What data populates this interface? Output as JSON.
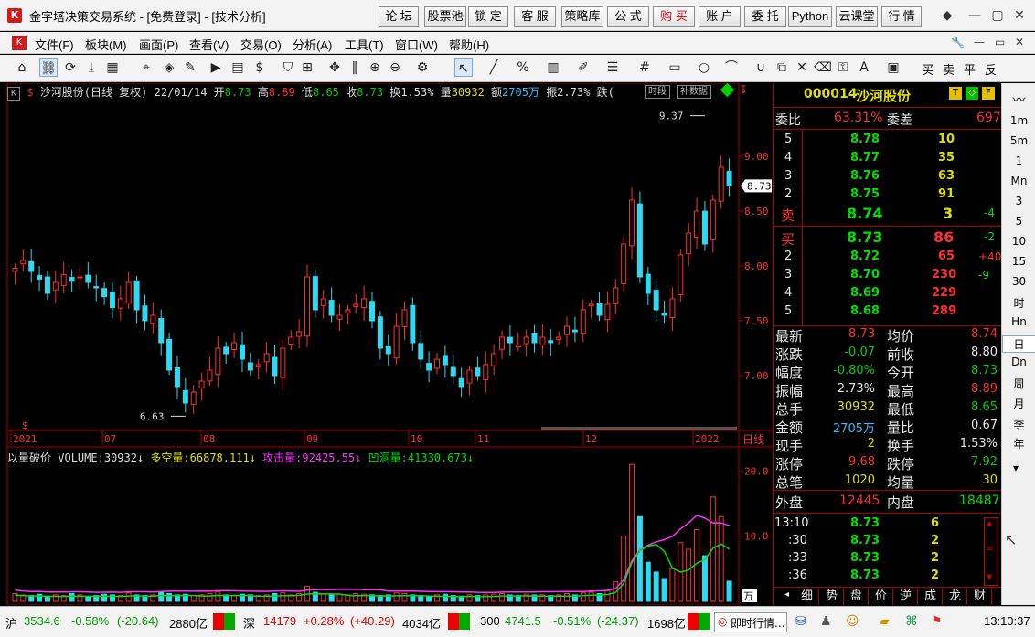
{
  "title_bar": {
    "icon": "K",
    "title": "金字塔决策交易系统 - [免费登录] - [技术分析]",
    "buttons": [
      "论 坛",
      "股票池",
      "锁 定",
      "客 服",
      "策略库",
      "公 式",
      "购 买",
      "账 户",
      "委 托",
      "Python",
      "云课堂",
      "行 情"
    ],
    "button_colors": [
      "#000000",
      "#000000",
      "#000000",
      "#000000",
      "#000000",
      "#000000",
      "#e00000",
      "#000000",
      "#000000",
      "#000000",
      "#000000",
      "#000000"
    ],
    "window_controls": [
      "◆",
      "—",
      "▢",
      "✕"
    ]
  },
  "menu": {
    "items": [
      "文件(F)",
      "板块(M)",
      "画面(P)",
      "查看(V)",
      "交易(O)",
      "分析(A)",
      "工具(T)",
      "窗口(W)",
      "帮助(H)"
    ],
    "mdi_controls": [
      "🔧",
      "—",
      "▭",
      "✕"
    ]
  },
  "toolbar": {
    "trade_buttons": [
      "买",
      "卖",
      "平",
      "反"
    ]
  },
  "kline_header": {
    "badge": "K",
    "name": "沙河股份(日线 复权) 22/01/14",
    "open_label": "开",
    "open": "8.73",
    "high_label": "高",
    "high": "8.89",
    "low_label": "低",
    "low": "8.65",
    "close_label": "收",
    "close": "8.73",
    "turnover_label": "换",
    "turnover": "1.53%",
    "volume_label": "量",
    "volume": "30932",
    "amount_label": "额",
    "amount": "2705万",
    "amplitude_label": "振",
    "amplitude": "2.73%",
    "change_label": "跌(",
    "tag_period": "时段",
    "tag_data": "补数据"
  },
  "volume_header": {
    "name": "以量破价",
    "volume_label": "VOLUME:",
    "volume": "30932",
    "duokong_label": "多空量:",
    "duokong": "66878.111",
    "gongji_label": "攻击量:",
    "gongji": "92425.55",
    "aodong_label": "凹洞量:",
    "aodong": "41330.673"
  },
  "chart_data": {
    "type": "candlestick",
    "title": "沙河股份(日线 复权)",
    "x_tick_labels": [
      "2021",
      "07",
      "08",
      "09",
      "10",
      "11",
      "12",
      "2022"
    ],
    "x_axis_unit": "日线",
    "price_axis": {
      "ticks": [
        7.0,
        7.5,
        8.0,
        8.5,
        9.0
      ],
      "range": [
        6.5,
        9.5
      ]
    },
    "volume_axis": {
      "ticks": [
        "20.0",
        "10.0"
      ],
      "unit": "万",
      "range": [
        0,
        22
      ]
    },
    "annotations": {
      "high": "9.37",
      "low": "6.63",
      "last": "8.73"
    },
    "close_series": [
      7.98,
      8.05,
      7.95,
      7.88,
      7.75,
      7.85,
      7.92,
      7.86,
      7.9,
      7.85,
      7.8,
      7.72,
      7.62,
      7.7,
      7.85,
      7.6,
      7.5,
      7.55,
      7.3,
      7.05,
      6.9,
      6.75,
      6.85,
      6.95,
      7.05,
      7.25,
      7.2,
      7.3,
      7.15,
      7.05,
      7.1,
      7.2,
      7.0,
      7.25,
      7.35,
      7.4,
      7.9,
      7.6,
      7.7,
      7.55,
      7.55,
      7.6,
      7.65,
      7.7,
      7.5,
      7.25,
      7.2,
      7.45,
      7.6,
      7.3,
      7.15,
      7.05,
      7.15,
      7.1,
      7.0,
      6.9,
      7.05,
      7.0,
      7.1,
      7.2,
      7.35,
      7.3,
      7.28,
      7.35,
      7.3,
      7.35,
      7.3,
      7.35,
      7.45,
      7.4,
      7.6,
      7.65,
      7.55,
      7.65,
      7.8,
      8.2,
      8.6,
      7.9,
      7.75,
      7.6,
      7.55,
      7.7,
      8.1,
      8.3,
      8.5,
      8.2,
      8.6,
      8.9,
      8.73
    ],
    "volume_series": [
      1.2,
      1.0,
      0.9,
      1.1,
      0.8,
      1.0,
      0.9,
      1.2,
      1.0,
      0.8,
      0.9,
      1.1,
      1.0,
      0.9,
      1.3,
      1.0,
      0.9,
      1.0,
      1.4,
      1.2,
      1.0,
      1.1,
      0.9,
      1.0,
      1.2,
      1.5,
      1.0,
      0.9,
      1.1,
      1.0,
      0.9,
      1.0,
      1.2,
      1.3,
      1.0,
      1.2,
      2.3,
      1.4,
      1.2,
      1.0,
      1.1,
      1.0,
      1.2,
      1.1,
      1.0,
      0.9,
      1.0,
      1.3,
      1.2,
      1.0,
      0.9,
      0.8,
      1.0,
      1.1,
      0.9,
      0.8,
      1.0,
      0.9,
      1.0,
      1.1,
      1.2,
      1.0,
      0.9,
      1.1,
      1.0,
      1.0,
      0.9,
      1.0,
      1.2,
      1.0,
      1.3,
      1.4,
      1.2,
      1.6,
      3.0,
      10.0,
      21.0,
      13.0,
      6.0,
      4.5,
      3.5,
      5.0,
      9.0,
      8.0,
      11.0,
      7.0,
      16.0,
      13.0,
      3.1
    ]
  },
  "quote": {
    "code": "000014",
    "name": "沙河股份",
    "weibi_label": "委比",
    "weibi": "63.31%",
    "weicha_label": "委差",
    "weicha": "697",
    "sells": [
      {
        "level": "5",
        "price": "8.78",
        "vol": "10",
        "chg": ""
      },
      {
        "level": "4",
        "price": "8.77",
        "vol": "35",
        "chg": ""
      },
      {
        "level": "3",
        "price": "8.76",
        "vol": "63",
        "chg": ""
      },
      {
        "level": "2",
        "price": "8.75",
        "vol": "91",
        "chg": ""
      }
    ],
    "sell1": {
      "label": "卖",
      "price": "8.74",
      "vol": "3",
      "chg": "-4"
    },
    "buy1": {
      "label": "买",
      "price": "8.73",
      "vol": "86",
      "chg": "-2"
    },
    "buys": [
      {
        "level": "2",
        "price": "8.72",
        "vol": "65",
        "chg": "+40"
      },
      {
        "level": "3",
        "price": "8.70",
        "vol": "230",
        "chg": "-9"
      },
      {
        "level": "4",
        "price": "8.69",
        "vol": "229",
        "chg": ""
      },
      {
        "level": "5",
        "price": "8.68",
        "vol": "289",
        "chg": ""
      }
    ],
    "stats": [
      {
        "l1": "最新",
        "v1": "8.73",
        "c1": "#ff3030",
        "l2": "均价",
        "v2": "8.74",
        "c2": "#ff3030"
      },
      {
        "l1": "涨跌",
        "v1": "-0.07",
        "c1": "#00d000",
        "l2": "前收",
        "v2": "8.80",
        "c2": "#e8e8e8"
      },
      {
        "l1": "幅度",
        "v1": "-0.80%",
        "c1": "#00d000",
        "l2": "今开",
        "v2": "8.73",
        "c2": "#00d000"
      },
      {
        "l1": "振幅",
        "v1": "2.73%",
        "c1": "#e8e8e8",
        "l2": "最高",
        "v2": "8.89",
        "c2": "#ff3030"
      },
      {
        "l1": "总手",
        "v1": "30932",
        "c1": "#e0e000",
        "l2": "最低",
        "v2": "8.65",
        "c2": "#00d000"
      },
      {
        "l1": "金额",
        "v1": "2705万",
        "c1": "#30c0ff",
        "l2": "量比",
        "v2": "0.67",
        "c2": "#e8e8e8"
      },
      {
        "l1": "现手",
        "v1": "2",
        "c1": "#e0e000",
        "l2": "换手",
        "v2": "1.53%",
        "c2": "#e8e8e8"
      },
      {
        "l1": "涨停",
        "v1": "9.68",
        "c1": "#ff3030",
        "l2": "跌停",
        "v2": "7.92",
        "c2": "#00d000"
      },
      {
        "l1": "总笔",
        "v1": "1020",
        "c1": "#e0e000",
        "l2": "均量",
        "v2": "30",
        "c2": "#e0e000"
      }
    ],
    "outer_label": "外盘",
    "outer": "12445",
    "inner_label": "内盘",
    "inner": "18487",
    "ticks": [
      {
        "time": "13:10",
        "price": "8.73",
        "vol": "6"
      },
      {
        "time": ":30",
        "price": "8.73",
        "vol": "2"
      },
      {
        "time": ":33",
        "price": "8.73",
        "vol": "2"
      },
      {
        "time": ":36",
        "price": "8.73",
        "vol": "2"
      }
    ],
    "bottom_tabs": [
      "细",
      "势",
      "盘",
      "价",
      "逆",
      "成",
      "龙",
      "财"
    ]
  },
  "side_tabs": [
    "1m",
    "5m",
    "1",
    "Mn",
    "3",
    "5",
    "10",
    "15",
    "30",
    "时",
    "Hn",
    "日",
    "Dn",
    "周",
    "月",
    "季",
    "年"
  ],
  "status_bar": {
    "sh_label": "沪",
    "sh_index": "3534.6",
    "sh_pct": "-0.58%",
    "sh_chg": "(-20.64)",
    "sh_amt": "2880亿",
    "sz_label": "深",
    "sz_index": "14179",
    "sz_pct": "+0.28%",
    "sz_chg": "(+40.29)",
    "sz_amt": "4034亿",
    "cy_label": "300",
    "cy_index": "4741.5",
    "cy_pct": "-0.51%",
    "cy_chg": "(-24.37)",
    "cy_amt": "1698亿",
    "realtime_label": "即时行情...",
    "clock": "13:10:37"
  }
}
